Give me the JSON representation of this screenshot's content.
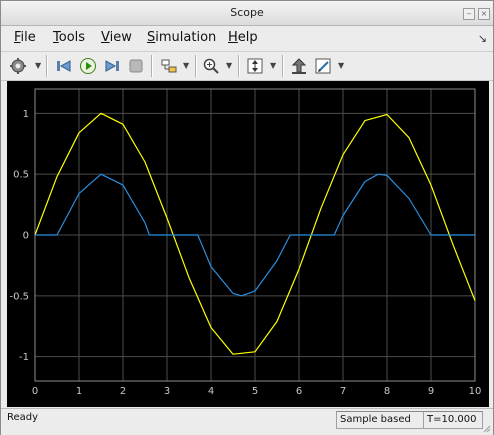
{
  "window": {
    "title": "Scope"
  },
  "menu": [
    {
      "label": "File",
      "key": "F",
      "rest": "ile"
    },
    {
      "label": "Tools",
      "key": "T",
      "rest": "ools"
    },
    {
      "label": "View",
      "key": "V",
      "rest": "iew"
    },
    {
      "label": "Simulation",
      "key": "S",
      "rest": "imulation"
    },
    {
      "label": "Help",
      "key": "H",
      "rest": "elp"
    }
  ],
  "toolbar": {
    "icons": [
      "gear-icon",
      "step-back-icon",
      "run-icon",
      "step-forward-icon",
      "stop-icon",
      "highlight-icon",
      "zoom-in-icon",
      "autoscale-icon",
      "restore-icon",
      "style-icon"
    ]
  },
  "status": {
    "left": "Ready",
    "mode": "Sample based",
    "time": "T=10.000"
  },
  "colors": {
    "plot_bg": "#000000",
    "grid": "#4d4d4d",
    "axis_text": "#c8c8c8",
    "series_1": "#ffff00",
    "series_2": "#2a8fe0"
  },
  "chart_data": {
    "type": "line",
    "title": "",
    "xlabel": "",
    "ylabel": "",
    "xlim": [
      0,
      10
    ],
    "ylim": [
      -1.2,
      1.2
    ],
    "xticks": [
      0,
      1,
      2,
      3,
      4,
      5,
      6,
      7,
      8,
      9,
      10
    ],
    "yticks": [
      -1,
      -0.5,
      0,
      0.5,
      1
    ],
    "xtick_labels": [
      "0",
      "1",
      "2",
      "3",
      "4",
      "5",
      "6",
      "7",
      "8",
      "9",
      "10"
    ],
    "ytick_labels": [
      "-1",
      "-0.5",
      "0",
      "0.5",
      "1"
    ],
    "grid": true,
    "series": [
      {
        "color": "#ffff00",
        "x": [
          0,
          0.5,
          1,
          1.5,
          2,
          2.5,
          3,
          3.5,
          4,
          4.5,
          5,
          5.5,
          6,
          6.5,
          7,
          7.5,
          8,
          8.5,
          9,
          9.5,
          10
        ],
        "y": [
          0,
          0.48,
          0.84,
          1.0,
          0.91,
          0.6,
          0.14,
          -0.35,
          -0.76,
          -0.98,
          -0.96,
          -0.71,
          -0.28,
          0.22,
          0.66,
          0.94,
          0.99,
          0.8,
          0.41,
          -0.08,
          -0.54
        ]
      },
      {
        "color": "#2a8fe0",
        "x": [
          0,
          0.5,
          1,
          1.5,
          2,
          2.5,
          2.6,
          3,
          3.5,
          3.7,
          4,
          4.5,
          4.7,
          5,
          5.5,
          5.8,
          6,
          6.5,
          6.8,
          7,
          7.5,
          7.8,
          8,
          8.5,
          9,
          9.5,
          10
        ],
        "y": [
          0,
          0,
          0.34,
          0.5,
          0.41,
          0.1,
          0,
          0,
          0,
          0,
          -0.26,
          -0.48,
          -0.5,
          -0.46,
          -0.21,
          0,
          0,
          0,
          0,
          0.16,
          0.44,
          0.5,
          0.49,
          0.3,
          0,
          0,
          0
        ]
      }
    ]
  }
}
